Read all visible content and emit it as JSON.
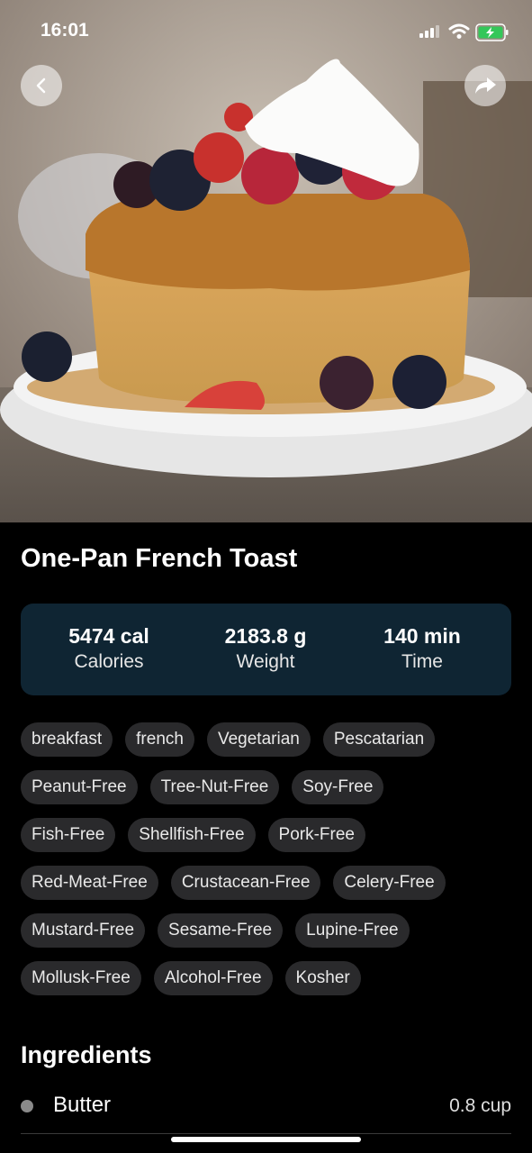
{
  "status": {
    "time": "16:01"
  },
  "recipe": {
    "title": "One-Pan French Toast"
  },
  "stats": [
    {
      "value": "5474 cal",
      "label": "Calories"
    },
    {
      "value": "2183.8 g",
      "label": "Weight"
    },
    {
      "value": "140 min",
      "label": "Time"
    }
  ],
  "tags": [
    [
      "breakfast",
      "french",
      "Vegetarian",
      "Pescatarian"
    ],
    [
      "Peanut-Free",
      "Tree-Nut-Free",
      "Soy-Free"
    ],
    [
      "Fish-Free",
      "Shellfish-Free",
      "Pork-Free"
    ],
    [
      "Red-Meat-Free",
      "Crustacean-Free",
      "Celery-Free"
    ],
    [
      "Mustard-Free",
      "Sesame-Free",
      "Lupine-Free"
    ],
    [
      "Mollusk-Free",
      "Alcohol-Free",
      "Kosher"
    ]
  ],
  "ingredients": {
    "title": "Ingredients",
    "items": [
      {
        "name": "Butter",
        "qty": "0.8 cup"
      }
    ]
  },
  "icons": {
    "back": "chevron-left-icon",
    "share": "share-arrow-icon"
  },
  "colors": {
    "stats_bg": "#0f2533",
    "tag_bg": "#2a2a2c",
    "battery": "#34c759"
  }
}
